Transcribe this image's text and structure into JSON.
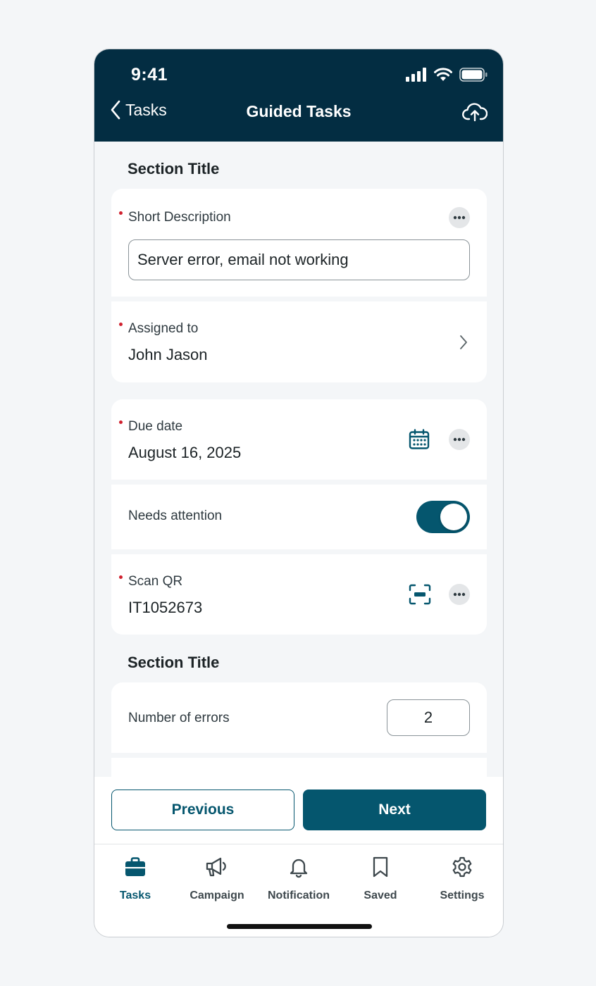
{
  "status_bar": {
    "time": "9:41"
  },
  "nav": {
    "back_label": "Tasks",
    "title": "Guided Tasks"
  },
  "sections": [
    {
      "title": "Section Title"
    },
    {
      "title": "Section Title"
    }
  ],
  "fields": {
    "short_description": {
      "label": "Short Description",
      "value": "Server error, email not working",
      "required": true
    },
    "assigned_to": {
      "label": "Assigned to",
      "value": "John Jason",
      "required": true
    },
    "due_date": {
      "label": "Due date",
      "value": "August 16, 2025",
      "required": true
    },
    "needs_attention": {
      "label": "Needs attention",
      "checked": true
    },
    "scan_qr": {
      "label": "Scan QR",
      "value": "IT1052673",
      "required": true
    },
    "number_of_errors": {
      "label": "Number of errors",
      "value": "2"
    }
  },
  "actions": {
    "previous_label": "Previous",
    "next_label": "Next"
  },
  "tabbar": {
    "items": [
      {
        "label": "Tasks",
        "icon": "briefcase-icon",
        "active": true
      },
      {
        "label": "Campaign",
        "icon": "megaphone-icon",
        "active": false
      },
      {
        "label": "Notification",
        "icon": "bell-icon",
        "active": false
      },
      {
        "label": "Saved",
        "icon": "bookmark-icon",
        "active": false
      },
      {
        "label": "Settings",
        "icon": "gear-icon",
        "active": false
      }
    ]
  },
  "colors": {
    "header_bg": "#032d42",
    "accent": "#05566e",
    "required_dot": "#d0202e",
    "page_bg": "#f4f6f8"
  }
}
